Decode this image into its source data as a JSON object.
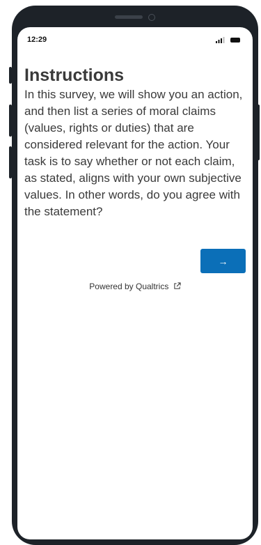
{
  "status_bar": {
    "time": "12:29",
    "signal_icon": "cellular-signal-icon",
    "battery_icon": "battery-icon"
  },
  "page": {
    "title": "Instructions",
    "body": "In this survey, we will show you an action, and then list a series of moral claims (values, rights or duties) that are considered relevant for the action. Your task is to say whether or not each claim, as stated, aligns with your own subjective values. In other words, do you agree with the statement?"
  },
  "next_button": {
    "label": "→",
    "color": "#0b6fb8"
  },
  "footer": {
    "powered_by": "Powered by Qualtrics",
    "external_icon": "external-link-icon"
  }
}
